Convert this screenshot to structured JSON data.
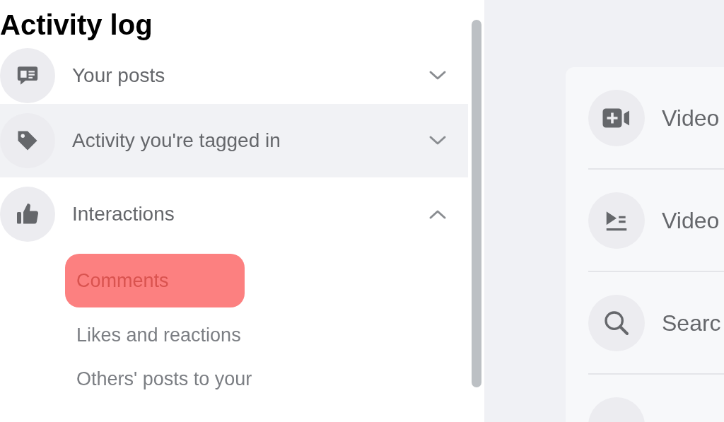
{
  "title": "Activity log",
  "sections": [
    {
      "label": "Your posts",
      "expanded": false,
      "hovered": false
    },
    {
      "label": "Activity you're tagged in",
      "expanded": false,
      "hovered": true
    },
    {
      "label": "Interactions",
      "expanded": true,
      "hovered": false,
      "children": [
        {
          "label": "Comments",
          "selected": true
        },
        {
          "label": "Likes and reactions",
          "selected": false
        },
        {
          "label": "Others' posts to your",
          "selected": false
        }
      ]
    }
  ],
  "panel_items": [
    {
      "label": "Video"
    },
    {
      "label": "Video"
    },
    {
      "label": "Searc"
    }
  ]
}
